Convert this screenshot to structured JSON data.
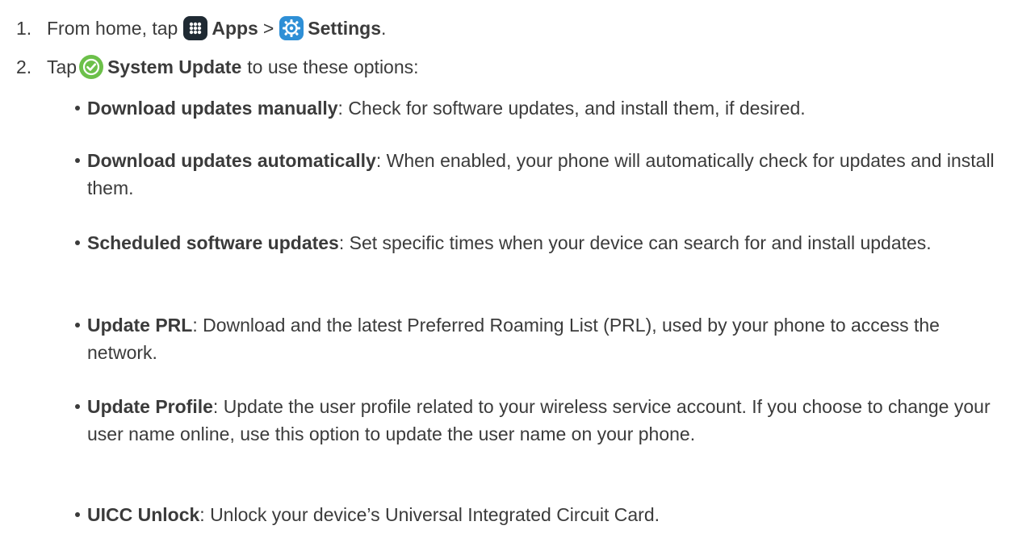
{
  "steps": [
    {
      "number": "1.",
      "text_before": "From home, tap",
      "apps_label": "Apps",
      "separator": ">",
      "settings_label": "Settings",
      "end": "."
    },
    {
      "number": "2.",
      "text_before": "Tap",
      "system_update_label": "System Update",
      "text_after": "to use these options:"
    }
  ],
  "options": [
    {
      "term": "Download updates manually",
      "description": ": Check for software updates, and install them, if desired."
    },
    {
      "term": "Download updates automatically",
      "description": ": When enabled, your phone will automatically check for updates and install them."
    },
    {
      "term": "Scheduled software updates",
      "description": ": Set specific times when your device can search for and install updates."
    },
    {
      "term": "Update PRL",
      "description": ": Download and the latest Preferred Roaming List (PRL), used by your phone to access the network."
    },
    {
      "term": "Update Profile",
      "description": ": Update the user profile related to your wireless service account. If you choose to change your user name online, use this option to update the user name on your phone."
    },
    {
      "term": "UICC Unlock",
      "description": ": Unlock your device’s Universal Integrated Circuit Card."
    }
  ],
  "icons": {
    "apps": "apps-grid-icon",
    "settings": "settings-gear-icon",
    "system_update": "check-circle-icon"
  },
  "colors": {
    "apps_icon_bg": "#1f2a33",
    "settings_icon_bg": "#2e8fd6",
    "system_update_icon_bg": "#6cc04a",
    "text": "#3b3b3b"
  }
}
